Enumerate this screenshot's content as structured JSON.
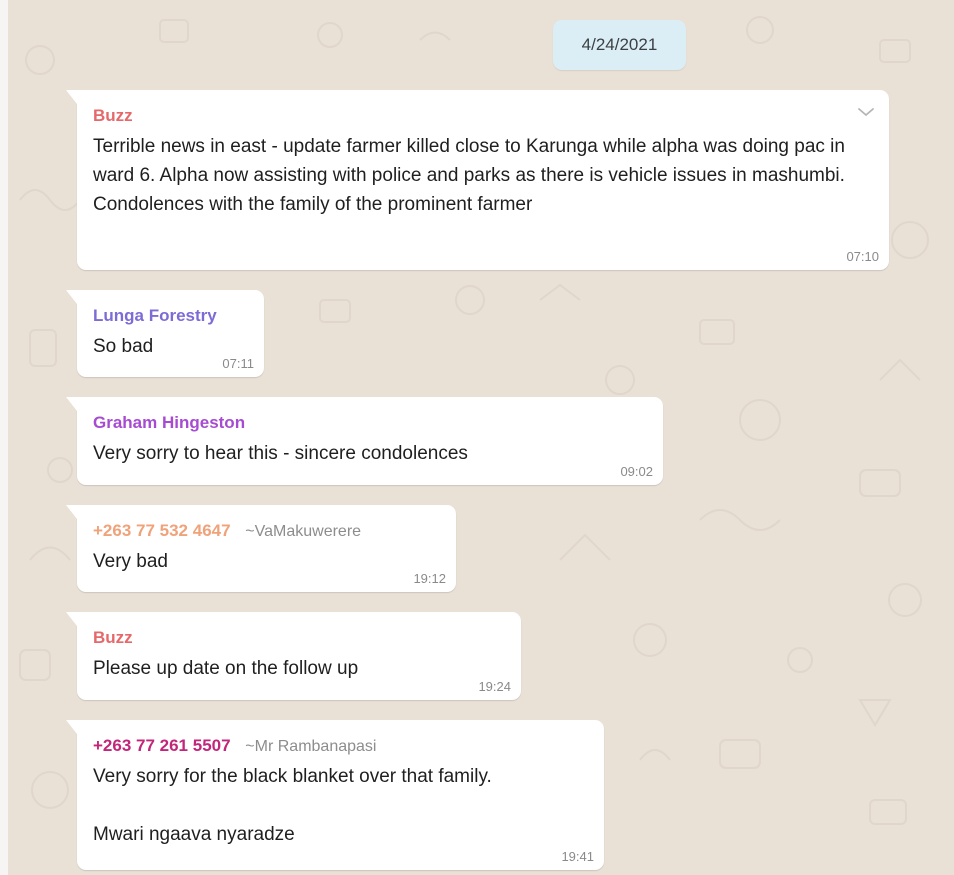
{
  "chat": {
    "date_label": "4/24/2021",
    "colors": {
      "background": "#e9e0d6",
      "date_pill": "#dbeef6",
      "bubble": "#ffffff"
    },
    "messages": [
      {
        "sender": "Buzz",
        "sender_color": "#e5696b",
        "alias": "",
        "text": "Terrible news in east - update farmer killed close to Karunga while alpha was doing pac in ward 6. Alpha now assisting with police and parks as there is vehicle issues in mashumbi. Condolences with the family of the prominent farmer",
        "time": "07:10",
        "menu_icon": "chevron-down-icon"
      },
      {
        "sender": "Lunga Forestry",
        "sender_color": "#7d6bd6",
        "alias": "",
        "text": "So bad",
        "time": "07:11"
      },
      {
        "sender": "Graham Hingeston",
        "sender_color": "#a64bd2",
        "alias": "",
        "text": "Very sorry to hear this - sincere condolences",
        "time": "09:02"
      },
      {
        "sender": "+263 77 532 4647",
        "sender_color": "#f0a27a",
        "alias": "~VaMakuwerere",
        "text": "Very bad",
        "time": "19:12"
      },
      {
        "sender": "Buzz",
        "sender_color": "#e5696b",
        "alias": "",
        "text": "Please up date on the follow up",
        "time": "19:24"
      },
      {
        "sender": "+263 77 261 5507",
        "sender_color": "#c2257a",
        "alias": "~Mr Rambanapasi",
        "text": "Very sorry for the black blanket over that family.\n\nMwari ngaava nyaradze",
        "time": "19:41"
      }
    ]
  }
}
